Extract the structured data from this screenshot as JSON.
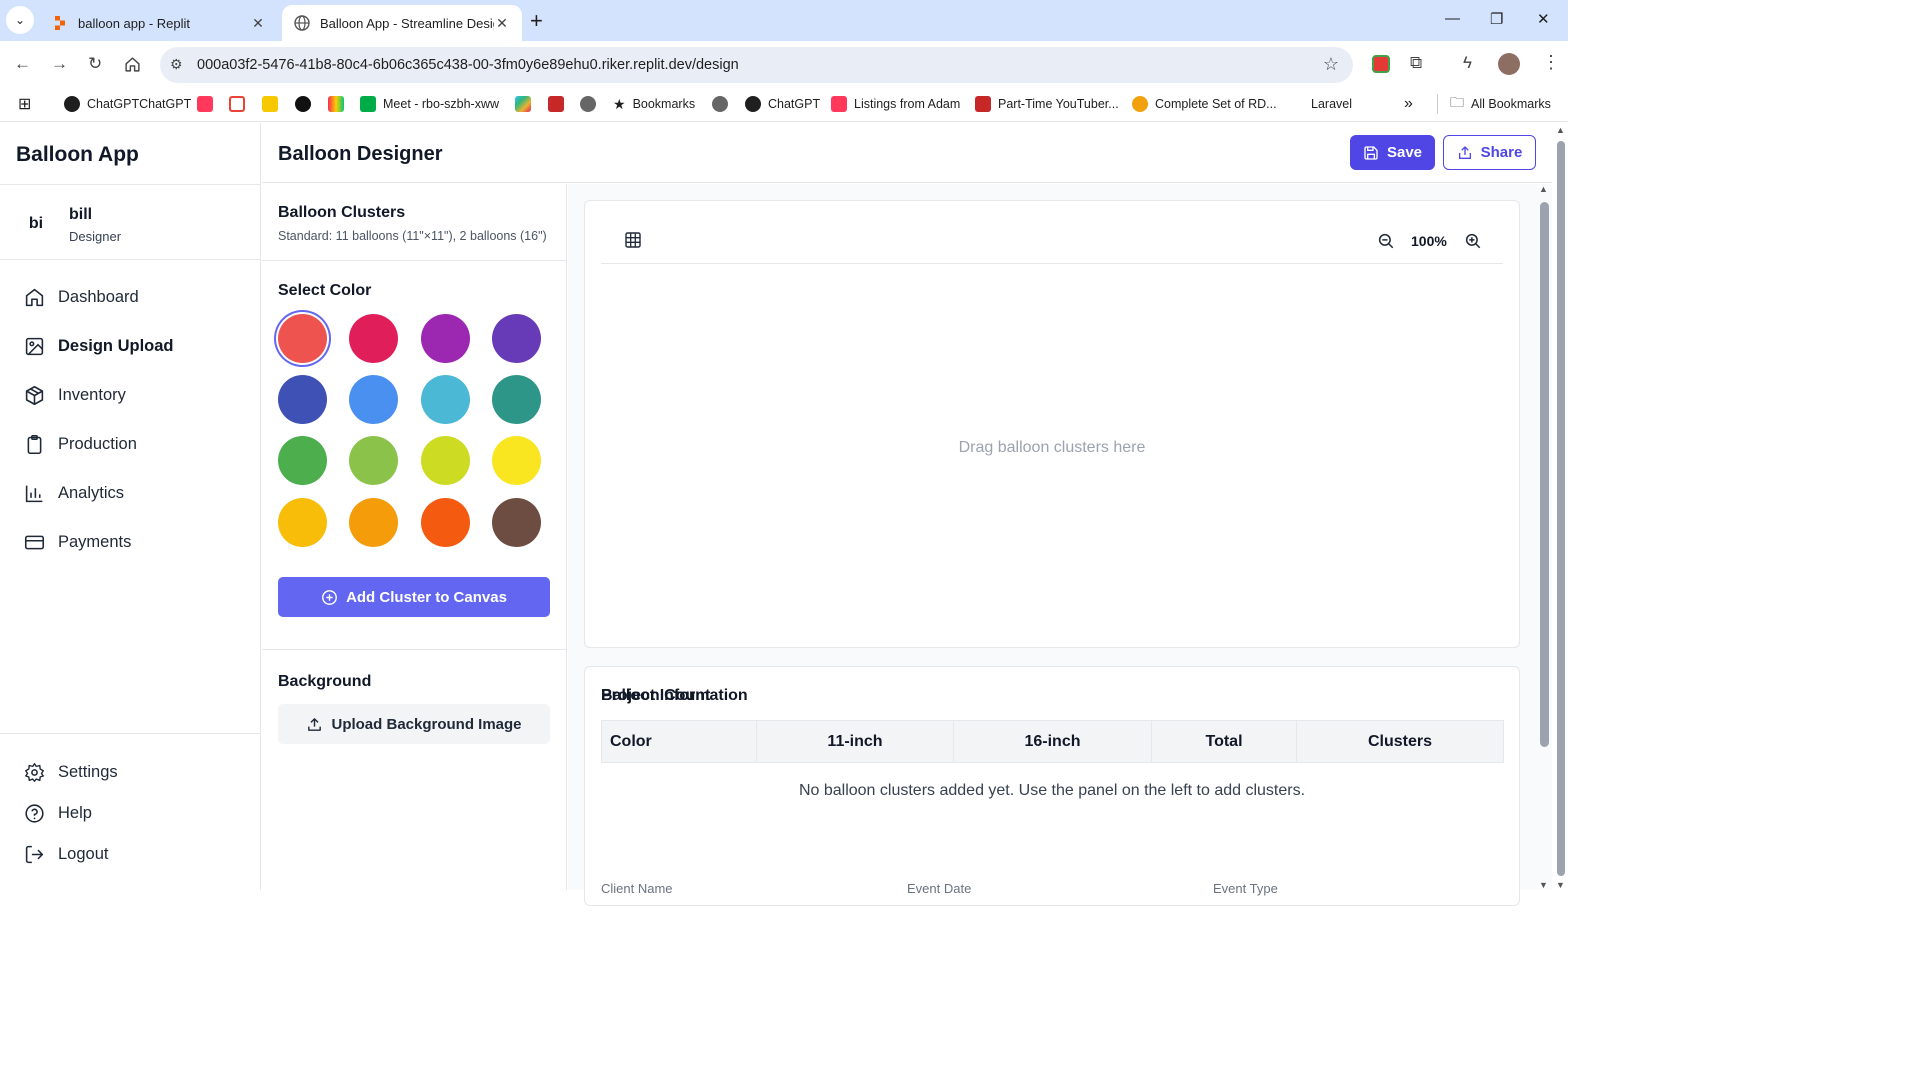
{
  "browser": {
    "tabs": [
      {
        "title": "balloon app - Replit",
        "close": "✕"
      },
      {
        "title": "Balloon App - Streamline Design",
        "close": "✕"
      }
    ],
    "new_tab": "+",
    "url": "000a03f2-5476-41b8-80c4-6b06c365c438-00-3fm0y6e89ehu0.riker.replit.dev/design",
    "bookmarks": [
      {
        "label": "ChatGPTChatGPT",
        "icon": "openai-icon"
      },
      {
        "label": "",
        "icon": "airbnb-icon"
      },
      {
        "label": "",
        "icon": "gmail-icon"
      },
      {
        "label": "",
        "icon": "ups-icon"
      },
      {
        "label": "",
        "icon": "medium-icon"
      },
      {
        "label": "",
        "icon": "monday-icon"
      },
      {
        "label": "Meet - rbo-szbh-xww",
        "icon": "meet-icon"
      },
      {
        "label": "",
        "icon": "slack-icon"
      },
      {
        "label": "",
        "icon": "bookmark-icon"
      },
      {
        "label": "",
        "icon": "globe-icon"
      },
      {
        "label": "Bookmarks",
        "icon": "star-icon"
      },
      {
        "label": "",
        "icon": "globe-icon"
      },
      {
        "label": "ChatGPT",
        "icon": "openai-icon"
      },
      {
        "label": "Listings from Adam",
        "icon": "airbnb-icon"
      },
      {
        "label": "Part-Time YouTuber...",
        "icon": "youtube-icon"
      },
      {
        "label": "Complete Set of RD...",
        "icon": "etsy-icon"
      },
      {
        "label": "Laravel",
        "icon": "laravel-icon"
      }
    ],
    "more_bookmarks": "»",
    "all_bookmarks": "All Bookmarks"
  },
  "sidebar": {
    "brand": "Balloon App",
    "user": {
      "initials": "bi",
      "name": "bill",
      "role": "Designer"
    },
    "nav": [
      {
        "label": "Dashboard",
        "icon": "home-icon"
      },
      {
        "label": "Design Upload",
        "icon": "image-icon"
      },
      {
        "label": "Inventory",
        "icon": "package-icon"
      },
      {
        "label": "Production",
        "icon": "clipboard-icon"
      },
      {
        "label": "Analytics",
        "icon": "bar-chart-icon"
      },
      {
        "label": "Payments",
        "icon": "credit-card-icon"
      }
    ],
    "bottom_nav": [
      {
        "label": "Settings",
        "icon": "gear-icon"
      },
      {
        "label": "Help",
        "icon": "help-circle-icon"
      },
      {
        "label": "Logout",
        "icon": "logout-icon"
      }
    ]
  },
  "header": {
    "title": "Balloon Designer",
    "save_label": "Save",
    "share_label": "Share"
  },
  "panel": {
    "clusters_title": "Balloon Clusters",
    "clusters_sub": "Standard: 11 balloons (11\"×11\"), 2 balloons (16\")",
    "color_title": "Select Color",
    "colors": [
      "#ef5350",
      "#e01e5a",
      "#9c27b0",
      "#673ab7",
      "#3f51b5",
      "#4a90f0",
      "#4bb8d6",
      "#2e9688",
      "#4cae4c",
      "#8bc34a",
      "#cddc23",
      "#f9e620",
      "#f7bd08",
      "#f59c0a",
      "#f45a10",
      "#6d4c41"
    ],
    "selected_color": "#ef5350",
    "add_label": "Add Cluster to Canvas",
    "bg_title": "Background",
    "upload_label": "Upload Background Image"
  },
  "canvas": {
    "zoom": "100%",
    "drop_hint": "Drag balloon clusters here"
  },
  "count": {
    "title": "Balloon Count",
    "columns": [
      "Color",
      "11-inch",
      "16-inch",
      "Total",
      "Clusters"
    ],
    "empty": "No balloon clusters added yet. Use the panel on the left to add clusters."
  },
  "project": {
    "title": "Project Information",
    "labels": [
      "Client Name",
      "Event Date",
      "Event Type"
    ]
  }
}
